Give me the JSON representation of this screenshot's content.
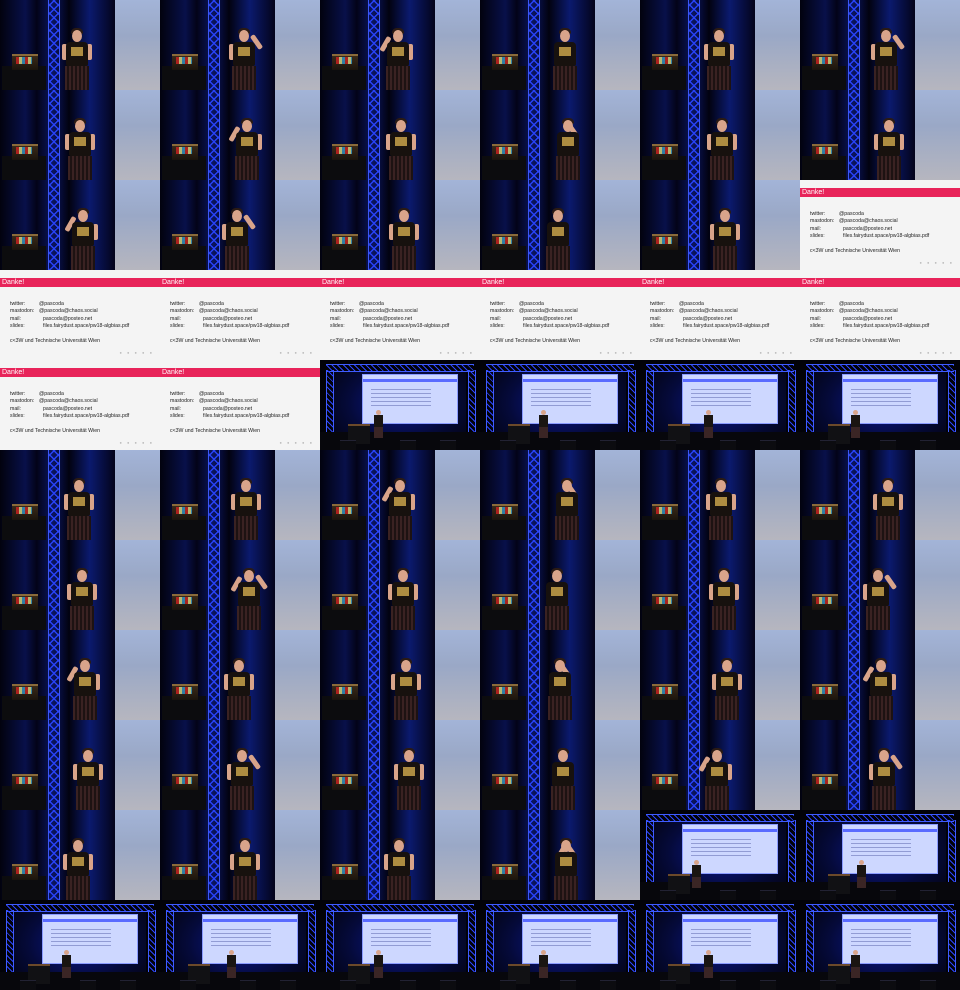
{
  "contact_sheet": {
    "columns": 6,
    "rows": 11,
    "frames": [
      "closeup",
      "closeup",
      "closeup",
      "closeup",
      "closeup",
      "closeup",
      "closeup",
      "closeup",
      "closeup",
      "closeup",
      "closeup",
      "closeup",
      "closeup",
      "closeup",
      "closeup",
      "closeup",
      "closeup",
      "slide",
      "slide",
      "slide",
      "slide",
      "slide",
      "slide",
      "slide",
      "slide",
      "slide",
      "wide",
      "wide",
      "wide",
      "wide",
      "closeup",
      "closeup",
      "closeup",
      "closeup",
      "closeup",
      "closeup",
      "closeup",
      "closeup",
      "closeup",
      "closeup",
      "closeup",
      "closeup",
      "closeup",
      "closeup",
      "closeup",
      "closeup",
      "closeup",
      "closeup",
      "closeup",
      "closeup",
      "closeup",
      "closeup",
      "closeup",
      "closeup",
      "closeup",
      "closeup",
      "closeup",
      "closeup",
      "wide",
      "wide",
      "wide",
      "wide",
      "wide",
      "wide",
      "wide",
      "wide"
    ]
  },
  "slide": {
    "title": "Danke!",
    "rows": [
      {
        "label": "twitter:",
        "value": "@pascoda"
      },
      {
        "label": "mastodon:",
        "value": "@pascoda@chaos.social"
      },
      {
        "label": "mail:",
        "value": "pascoda@posteo.net"
      },
      {
        "label": "slides:",
        "value": "files.fairydust.space/pw18-algbias.pdf"
      }
    ],
    "footer": "c<3W und Technische Universität Wien"
  }
}
